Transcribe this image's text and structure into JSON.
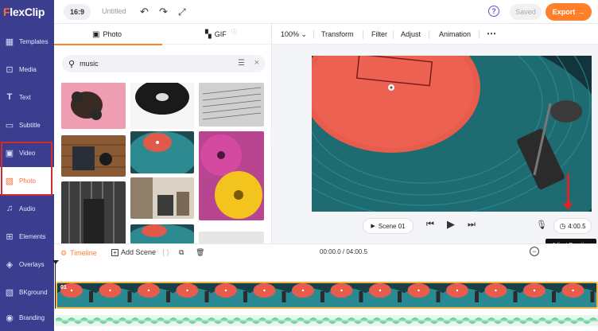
{
  "app": {
    "logo": "FlexClip",
    "ratio": "16:9",
    "title": "Untitled",
    "saved_label": "Saved",
    "export_label": "Export"
  },
  "sidebar": {
    "items": [
      {
        "label": "Templates",
        "icon": "templates-icon",
        "active": false
      },
      {
        "label": "Media",
        "icon": "media-icon",
        "active": false
      },
      {
        "label": "Text",
        "icon": "text-icon",
        "active": false
      },
      {
        "label": "Subtitle",
        "icon": "subtitle-icon",
        "active": false
      },
      {
        "label": "Video",
        "icon": "video-icon",
        "active": false
      },
      {
        "label": "Photo",
        "icon": "photo-icon",
        "active": true
      },
      {
        "label": "Audio",
        "icon": "audio-icon",
        "active": false
      },
      {
        "label": "Elements",
        "icon": "elements-icon",
        "active": false
      },
      {
        "label": "Overlays",
        "icon": "overlays-icon",
        "active": false
      },
      {
        "label": "BKground",
        "icon": "background-icon",
        "active": false
      },
      {
        "label": "Branding",
        "icon": "branding-icon",
        "active": false
      }
    ]
  },
  "media_panel": {
    "tabs": [
      {
        "label": "Photo",
        "active": true
      },
      {
        "label": "GIF",
        "active": false
      }
    ],
    "search_value": "music"
  },
  "edit_toolbar": {
    "zoom": "100%",
    "items": [
      "Transform",
      "Filter",
      "Adjust",
      "Animation"
    ]
  },
  "player": {
    "scene_label": "Scene 01",
    "duration": "4:00.5",
    "tooltip": "Adjust Duration"
  },
  "timeline": {
    "label": "Timeline",
    "add_scene": "Add Scene",
    "time": "00:00.0 / 04:00.5",
    "clip_label": "01"
  },
  "colors": {
    "sidebar": "#3b3d8f",
    "accent": "#ff7f2a",
    "annotation": "#d42c2c"
  }
}
